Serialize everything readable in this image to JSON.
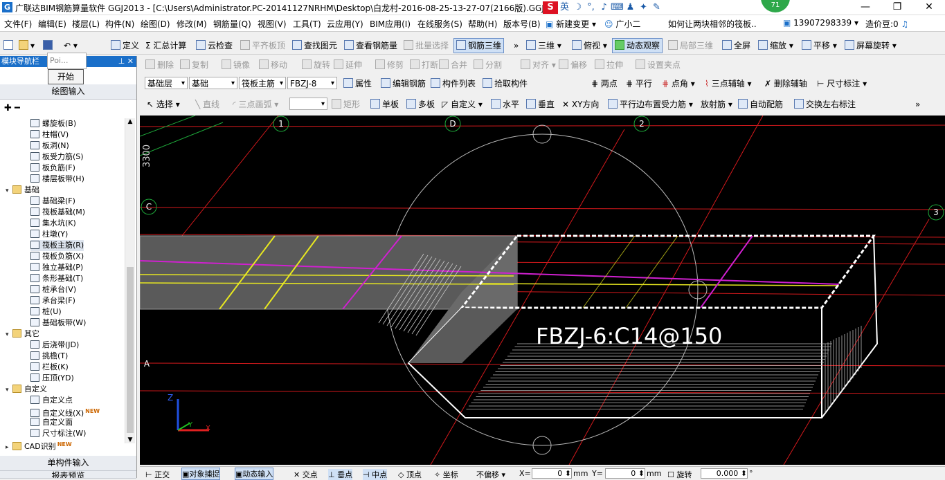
{
  "window": {
    "title": "广联达BIM钢筋算量软件 GGJ2013 - [C:\\Users\\Administrator.PC-20141127NRHM\\Desktop\\白龙村-2016-08-25-13-27-07(2166版).GGJ1",
    "badge": "71"
  },
  "menu": [
    "文件(F)",
    "编辑(E)",
    "楼层(L)",
    "构件(N)",
    "绘图(D)",
    "修改(M)",
    "钢筋量(Q)",
    "视图(V)",
    "工具(T)",
    "云应用(Y)",
    "BIM应用(I)",
    "在线服务(S)",
    "帮助(H)",
    "版本号(B)"
  ],
  "menu_extra": {
    "new_change": "新建变更",
    "assistant": "广小二",
    "question": "如何让两块相邻的筏板..",
    "phone": "13907298339",
    "cost": "造价豆:0"
  },
  "toolbar1": {
    "define": "定义",
    "calc": "汇总计算",
    "cloud_check": "云检查",
    "flat_top": "平齐板顶",
    "find": "查找图元",
    "view_rebar": "查看钢筋量",
    "batch": "批量选择",
    "rebar3d": "钢筋三维",
    "three_d": "三维",
    "top_view": "俯视",
    "dynamic": "动态观察",
    "local3d": "局部三维",
    "fullscreen": "全屏",
    "zoom": "缩放",
    "pan": "平移",
    "rotate": "屏幕旋转"
  },
  "toolbar2": [
    "删除",
    "复制",
    "镜像",
    "移动",
    "旋转",
    "延伸",
    "修剪",
    "打断",
    "合并",
    "分割",
    "对齐",
    "偏移",
    "拉伸",
    "设置夹点"
  ],
  "toolbar3": {
    "layer": "基础层",
    "category": "基础",
    "type": "筏板主筋",
    "item": "FBZJ-8",
    "props": "属性",
    "edit_rebar": "编辑钢筋",
    "list": "构件列表",
    "pick": "拾取构件",
    "two_point": "两点",
    "parallel": "平行",
    "point_angle": "点角",
    "three_point_aux": "三点辅轴",
    "delete_aux": "删除辅轴",
    "dim": "尺寸标注"
  },
  "toolbar4": {
    "select": "选择",
    "line": "直线",
    "arc": "三点画弧",
    "rect": "矩形",
    "single": "单板",
    "multi": "多板",
    "custom": "自定义",
    "horizontal": "水平",
    "vertical": "垂直",
    "xy": "XY方向",
    "parallel_edge": "平行边布置受力筋",
    "radial": "放射筋",
    "auto": "自动配筋",
    "swap": "交换左右标注"
  },
  "left_panel": {
    "header": "模块导航栏",
    "popup_text": "Poi...",
    "start": "开始",
    "draw_input": "绘图输入",
    "single_input": "单构件输入",
    "report": "报表预览",
    "tree": [
      {
        "label": "螺旋板(B)",
        "level": 2
      },
      {
        "label": "柱帽(V)",
        "level": 2
      },
      {
        "label": "板洞(N)",
        "level": 2
      },
      {
        "label": "板受力筋(S)",
        "level": 2
      },
      {
        "label": "板负筋(F)",
        "level": 2
      },
      {
        "label": "楼层板带(H)",
        "level": 2
      },
      {
        "label": "基础",
        "level": 1,
        "folder": true
      },
      {
        "label": "基础梁(F)",
        "level": 2
      },
      {
        "label": "筏板基础(M)",
        "level": 2
      },
      {
        "label": "集水坑(K)",
        "level": 2
      },
      {
        "label": "柱墩(Y)",
        "level": 2
      },
      {
        "label": "筏板主筋(R)",
        "level": 2,
        "selected": true
      },
      {
        "label": "筏板负筋(X)",
        "level": 2
      },
      {
        "label": "独立基础(P)",
        "level": 2
      },
      {
        "label": "条形基础(T)",
        "level": 2
      },
      {
        "label": "桩承台(V)",
        "level": 2
      },
      {
        "label": "承台梁(F)",
        "level": 2
      },
      {
        "label": "桩(U)",
        "level": 2
      },
      {
        "label": "基础板带(W)",
        "level": 2
      },
      {
        "label": "其它",
        "level": 1,
        "folder": true
      },
      {
        "label": "后浇带(JD)",
        "level": 2
      },
      {
        "label": "挑檐(T)",
        "level": 2
      },
      {
        "label": "栏板(K)",
        "level": 2
      },
      {
        "label": "压顶(YD)",
        "level": 2
      },
      {
        "label": "自定义",
        "level": 1,
        "folder": true
      },
      {
        "label": "自定义点",
        "level": 2
      },
      {
        "label": "自定义线(X)",
        "level": 2,
        "new": true
      },
      {
        "label": "自定义面",
        "level": 2
      },
      {
        "label": "尺寸标注(W)",
        "level": 2
      },
      {
        "label": "CAD识别",
        "level": 1,
        "folder": true,
        "new": true
      }
    ]
  },
  "canvas": {
    "rebar_label": "FBZJ-6:C14@150",
    "axis_labels": [
      "1",
      "D",
      "2",
      "C",
      "3",
      "A"
    ],
    "dim_text": "3300",
    "axis_z": "Z",
    "axis_y": "Y",
    "axis_x": "X"
  },
  "statusbar": {
    "ortho": "正交",
    "snap": "对象捕捉",
    "dynamic_input": "动态输入",
    "intersect": "交点",
    "perp": "垂点",
    "mid": "中点",
    "vertex": "顶点",
    "coord": "坐标",
    "offset": "不偏移",
    "x_label": "X=",
    "x_value": "0",
    "mm1": "mm",
    "y_label": "Y=",
    "y_value": "0",
    "mm2": "mm",
    "rotate": "旋转",
    "rotate_value": "0.000",
    "deg": "°"
  },
  "new_tag": "NEW",
  "colors": {
    "canvas_bg": "#000000",
    "grid_red": "#d4191c",
    "grid_green": "#1ea83a",
    "rebar_yellow": "#e8e820",
    "rebar_magenta": "#d020d0",
    "slab_gray": "#5a5a5a",
    "accent": "#1a6fc9"
  }
}
